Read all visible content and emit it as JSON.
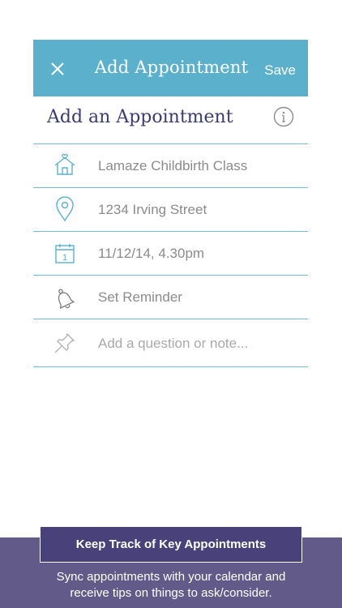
{
  "nav": {
    "title": "Add Appointment",
    "save_label": "Save"
  },
  "form": {
    "heading": "Add an Appointment",
    "rows": [
      {
        "icon": "house-heart-icon",
        "text": "Lamaze Childbirth Class"
      },
      {
        "icon": "location-pin-icon",
        "text": "1234 Irving Street"
      },
      {
        "icon": "calendar-icon",
        "text": "11/12/14, 4.30pm"
      },
      {
        "icon": "bell-icon",
        "text": "Set Reminder"
      },
      {
        "icon": "pushpin-icon",
        "placeholder": "Add a question or note..."
      }
    ],
    "calendar_day": "1"
  },
  "promo": {
    "title": "Keep Track of Key Appointments",
    "line1": "Sync appointments with your calendar and",
    "line2": "receive tips on things to ask/consider."
  },
  "colors": {
    "accent": "#5bb1cc",
    "heading": "#3b3a72",
    "footer": "#625b89",
    "footer_box": "#48417a",
    "divider": "#6fbdd6"
  }
}
